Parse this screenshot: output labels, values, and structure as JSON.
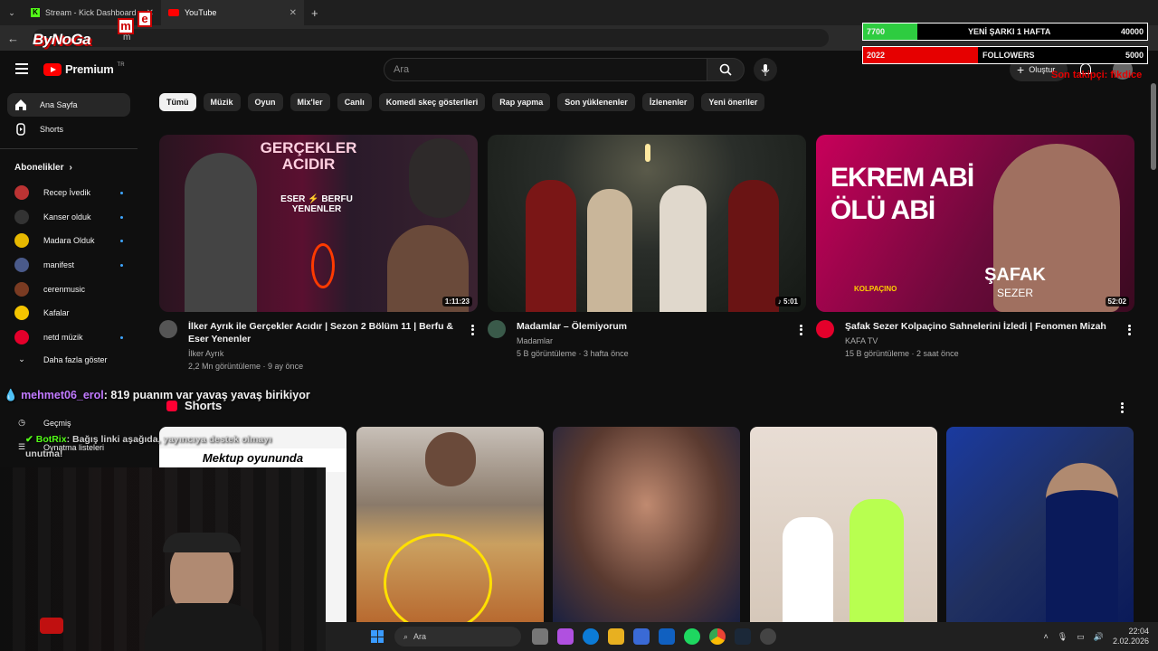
{
  "browser": {
    "tabs": [
      {
        "title": "Stream - Kick Dashboard"
      },
      {
        "title": "YouTube"
      }
    ],
    "address_fragment": "m"
  },
  "youtube": {
    "logo_text": "Premium",
    "logo_badge": "TR",
    "search_placeholder": "Ara",
    "create_label": "Oluştur",
    "chips": [
      "Tümü",
      "Müzik",
      "Oyun",
      "Mix'ler",
      "Canlı",
      "Komedi skeç gösterileri",
      "Rap yapma",
      "Son yüklenenler",
      "İzlenenler",
      "Yeni öneriler"
    ],
    "sidebar": {
      "home": "Ana Sayfa",
      "shorts": "Shorts",
      "subs_header": "Abonelikler",
      "subs": [
        {
          "name": "Recep İvedik",
          "color": "#b33"
        },
        {
          "name": "Kanser olduk",
          "color": "#333"
        },
        {
          "name": "Madara Olduk",
          "color": "#e6b800"
        },
        {
          "name": "manifest",
          "color": "#4a5a8a"
        },
        {
          "name": "cerenmusic",
          "color": "#7a3b22"
        },
        {
          "name": "Kafalar",
          "color": "#f4c400"
        },
        {
          "name": "netd müzik",
          "color": "#e4002b"
        }
      ],
      "show_more": "Daha fazla göster",
      "history": "Geçmiş",
      "playlists": "Oynatma listeleri"
    },
    "videos": [
      {
        "title": "İlker Ayrık ile Gerçekler Acıdır | Sezon 2 Bölüm 11 | Berfu & Eser Yenenler",
        "channel": "İlker Ayrık",
        "meta": "2,2 Mn görüntüleme · 9 ay önce",
        "duration": "1:11:23",
        "thumb_text1": "GERÇEKLER",
        "thumb_text2": "ACIDIR",
        "thumb_text3": "ESER ⚡ BERFU",
        "thumb_text4": "YENENLER"
      },
      {
        "title": "Madamlar – Ölemiyorum",
        "channel": "Madamlar",
        "meta": "5 B görüntüleme · 3 hafta önce",
        "duration": "♪ 5:01"
      },
      {
        "title": "Şafak Sezer Kolpaçino Sahnelerini İzledi | Fenomen Mizah",
        "channel": "KAFA TV",
        "meta": "15 B görüntüleme · 2 saat önce",
        "duration": "52:02",
        "thumb_text1": "EKREM ABİ",
        "thumb_text2": "ÖLÜ ABİ",
        "thumb_text3": "ŞAFAK",
        "thumb_text4": "SEZER",
        "thumb_text5": "KOLPAÇINO"
      }
    ],
    "shorts_header": "Shorts",
    "shorts_first_caption": "Mektup oyunundа"
  },
  "overlay": {
    "streamer_logo": "ByNoGa",
    "song_goal": {
      "current": "7700",
      "label": "YENİ ŞARKI 1 HAFTA",
      "target": "40000",
      "progress": 0.1925
    },
    "followers_goal": {
      "current": "2022",
      "label": "FOLLOWERS",
      "target": "5000",
      "progress": 0.4044
    },
    "last_follower": "Son takipçi: fikdice",
    "chat": [
      {
        "user": "mehmet06_erol",
        "text": ": 819 puanım var yavaş yavaş birikiyor"
      },
      {
        "user": "BotRix",
        "text": ": Bağış linki aşağıda, yayıncıya destek olmayı unutma!"
      }
    ]
  },
  "taskbar": {
    "search_placeholder": "Ara",
    "time": "22:04",
    "date": "2.02.2026"
  }
}
